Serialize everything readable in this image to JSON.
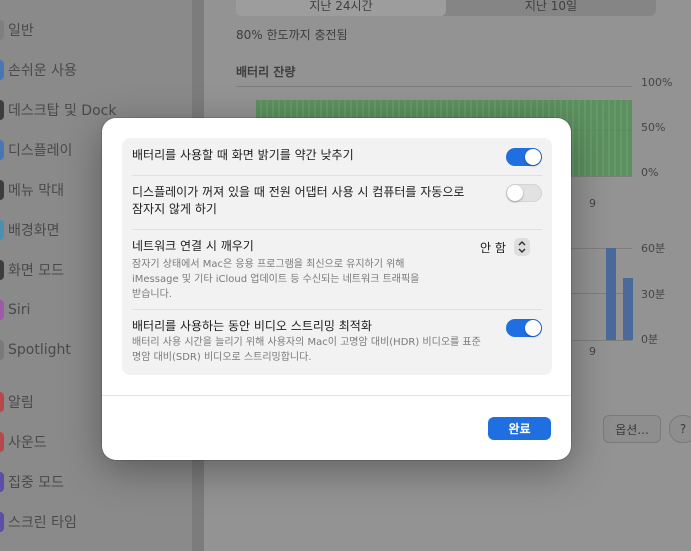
{
  "sidebar": {
    "items": [
      {
        "label": "일반",
        "color": "#8a8a8a"
      },
      {
        "label": "손쉬운 사용",
        "color": "#4a76b5"
      },
      {
        "label": "데스크탑 및 Dock",
        "color": "#3d3d3d"
      },
      {
        "label": "디스플레이",
        "color": "#4a76b5"
      },
      {
        "label": "메뉴 막대",
        "color": "#3d3d3d"
      },
      {
        "label": "배경화면",
        "color": "#4d8fb0"
      },
      {
        "label": "화면 모드",
        "color": "#3d3d3d"
      },
      {
        "label": "Siri",
        "color": "#9c5aa8"
      },
      {
        "label": "Spotlight",
        "color": "#7a7a7a"
      },
      {
        "label": "알림",
        "color": "#b5484a"
      },
      {
        "label": "사운드",
        "color": "#b5484a"
      },
      {
        "label": "집중 모드",
        "color": "#5b4fa8"
      },
      {
        "label": "스크린 타임",
        "color": "#5b4fa8"
      }
    ]
  },
  "background": {
    "segments": [
      "지난 24시간",
      "지난 10일"
    ],
    "charge_status": "80% 한도까지 충전됨",
    "battery_level_heading": "배터리 잔량",
    "battery_axis": [
      "100%",
      "50%",
      "0%"
    ],
    "usage_axis": [
      "60분",
      "30분",
      "0분"
    ],
    "x_tick": "9",
    "options_button": "옵션...",
    "help_button": "?"
  },
  "sheet": {
    "rows": [
      {
        "title": "배터리를 사용할 때 화면 밝기를 약간 낮추기",
        "toggle": true
      },
      {
        "title_line1": "디스플레이가 꺼져 있을 때 전원 어댑터 사용 시 컴퓨터를 자동으로",
        "title_line2": "잠자지 않게 하기",
        "toggle": false
      },
      {
        "title": "네트워크 연결 시 깨우기",
        "desc_line1": "잠자기 상태에서 Mac은 응용 프로그램을 최신으로 유지하기 위해",
        "desc_line2": "iMessage 및 기타 iCloud 업데이트 등 수신되는 네트워크 트래픽을",
        "desc_line3": "받습니다.",
        "value": "안 함"
      },
      {
        "title": "배터리를 사용하는 동안 비디오 스트리밍 최적화",
        "desc_line1": "배터리 사용 시간을 늘리기 위해 사용자의 Mac이 고명암 대비(HDR) 비디오를 표준",
        "desc_line2": "명암 대비(SDR) 비디오로 스트리밍합니다.",
        "toggle": true
      }
    ],
    "done_label": "완료",
    "accent": "#1f6fe0"
  }
}
